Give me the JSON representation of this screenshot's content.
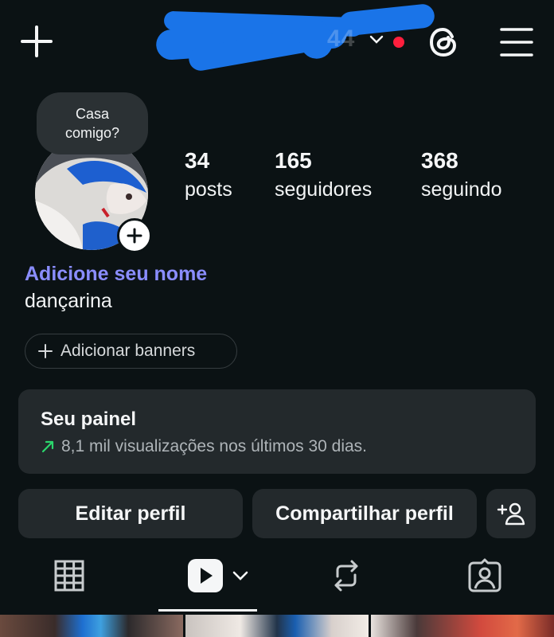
{
  "header": {
    "username": "44",
    "icons": {
      "new": "plus-icon",
      "switch": "chevron-down-icon",
      "threads": "threads-icon",
      "menu": "hamburger-menu-icon"
    },
    "colors": {
      "notification_dot": "#ff1f3d",
      "redaction": "#1a74e8"
    }
  },
  "profile": {
    "note_line1": "Casa",
    "note_line2": "comigo?",
    "stats": [
      {
        "value": "34",
        "label": "posts"
      },
      {
        "value": "165",
        "label": "seguidores"
      },
      {
        "value": "368",
        "label": "seguindo"
      }
    ],
    "name_prompt": "Adicione seu nome",
    "bio": "dançarina",
    "banner_button": "Adicionar banners"
  },
  "dashboard": {
    "title": "Seu painel",
    "subtitle": "8,1 mil visualizações nos últimos 30 dias.",
    "trend_color": "#2bd66c"
  },
  "actions": {
    "edit": "Editar perfil",
    "share": "Compartilhar perfil"
  },
  "tabs": [
    "grid-icon",
    "reels-icon",
    "repost-icon",
    "tagged-icon"
  ],
  "selected_tab": "reels-icon"
}
